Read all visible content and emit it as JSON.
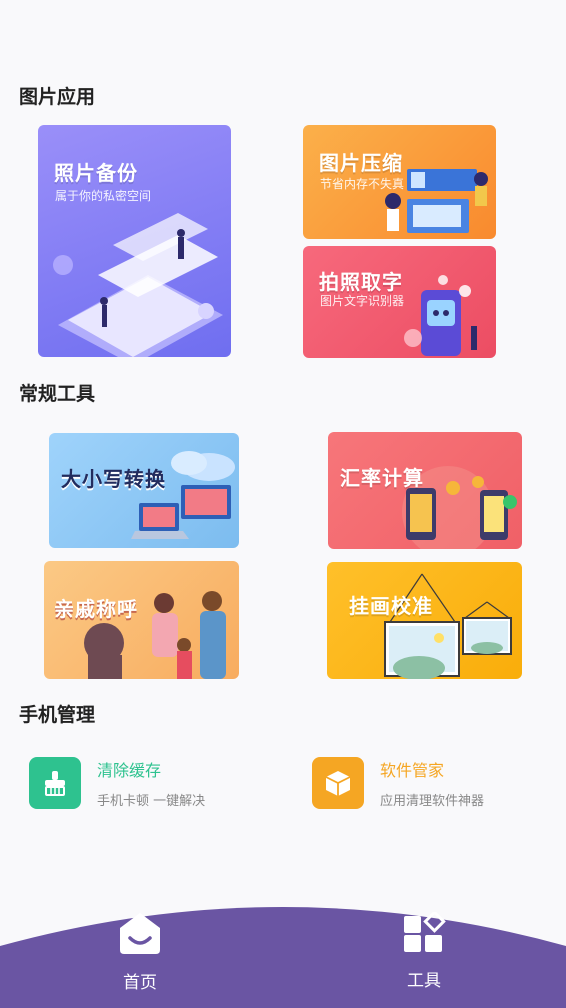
{
  "sections": {
    "photo_apps": "图片应用",
    "common_tools": "常规工具",
    "phone_management": "手机管理"
  },
  "photo_cards": {
    "backup": {
      "title": "照片备份",
      "subtitle": "属于你的私密空间"
    },
    "compress": {
      "title": "图片压缩",
      "subtitle": "节省内存不失真"
    },
    "ocr": {
      "title": "拍照取字",
      "subtitle": "图片文字识别器"
    }
  },
  "tool_cards": {
    "case_convert": {
      "title": "大小写转换"
    },
    "exchange_rate": {
      "title": "汇率计算"
    },
    "relatives": {
      "title": "亲戚称呼"
    },
    "picture_level": {
      "title": "挂画校准"
    }
  },
  "management": {
    "clean_cache": {
      "name": "清除缓存",
      "desc": "手机卡顿 一键解决",
      "color": "#2ec28f"
    },
    "software_manager": {
      "name": "软件管家",
      "desc": "应用清理软件神器",
      "color": "#f5a623"
    }
  },
  "tabbar": {
    "home": {
      "label": "首页",
      "icon": "home-envelope-icon"
    },
    "tools": {
      "label": "工具",
      "icon": "grid-tools-icon"
    },
    "color": "#6a55a3"
  },
  "colors": {
    "backup": "#8b82f7",
    "compress": "#f9a23c",
    "ocr": "#ef5a6f",
    "case_convert": "#8dc7f5",
    "exchange_rate": "#f06d72",
    "relatives": "#f9b46c",
    "picture_level": "#fbb40f"
  }
}
